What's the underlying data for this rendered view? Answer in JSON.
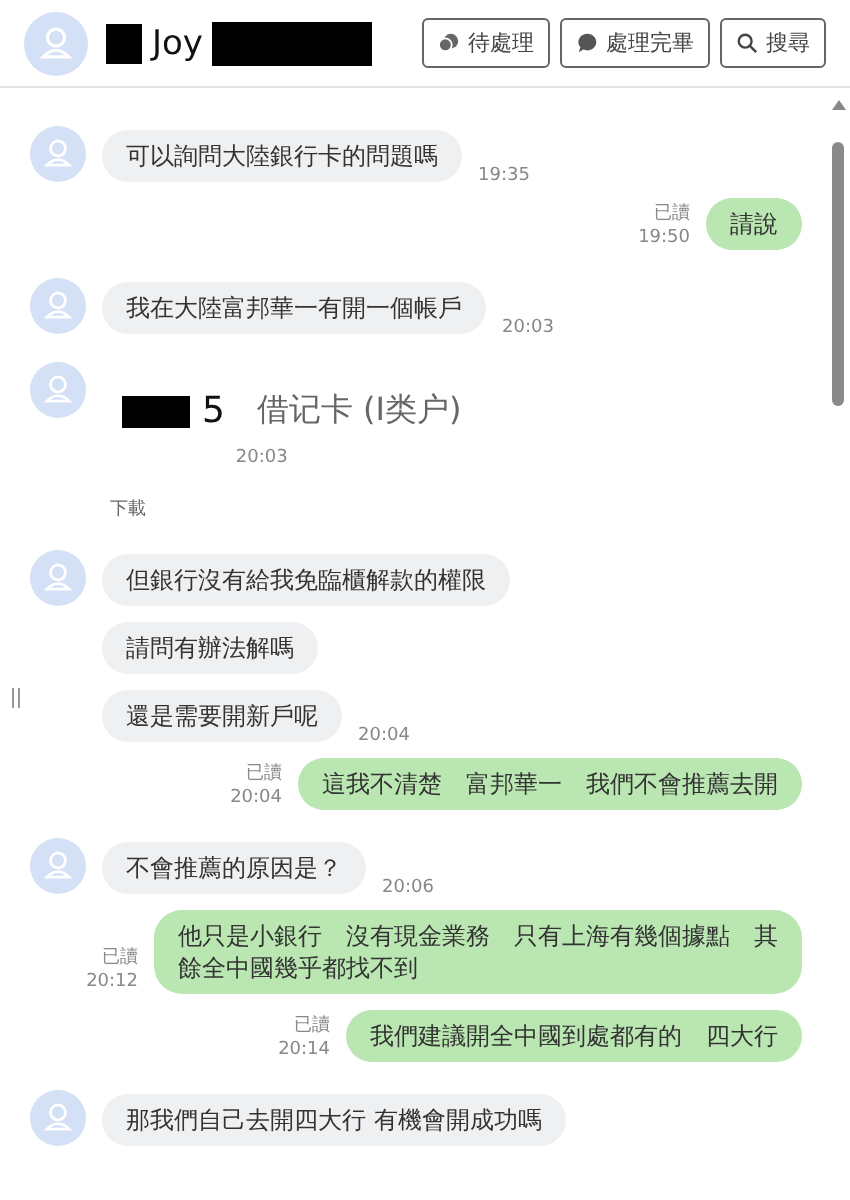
{
  "header": {
    "contact_name": "Joy",
    "buttons": [
      {
        "kind": "pending",
        "label": "待處理"
      },
      {
        "kind": "done",
        "label": "處理完畢"
      },
      {
        "kind": "search",
        "label": "搜尋"
      }
    ]
  },
  "messages": [
    {
      "kind": "incoming",
      "avatar": true,
      "text": "可以詢問大陸銀行卡的問題嗎",
      "time": "19:35"
    },
    {
      "kind": "outgoing",
      "text": "請說",
      "status": "已讀",
      "time": "19:50"
    },
    {
      "kind": "incoming",
      "avatar": true,
      "text": "我在大陸富邦華一有開一個帳戶",
      "time": "20:03"
    },
    {
      "kind": "image",
      "avatar": true,
      "number": "5",
      "caption": "借记卡 (I类户)",
      "time": "20:03",
      "download": "下載"
    },
    {
      "kind": "incoming",
      "avatar": true,
      "text": "但銀行沒有給我免臨櫃解款的權限"
    },
    {
      "kind": "incoming",
      "avatar": false,
      "text": "請問有辦法解嗎"
    },
    {
      "kind": "incoming",
      "avatar": false,
      "text": "還是需要開新戶呢",
      "time": "20:04"
    },
    {
      "kind": "outgoing",
      "text": "這我不清楚　富邦華一　我們不會推薦去開",
      "status": "已讀",
      "time": "20:04"
    },
    {
      "kind": "incoming",
      "avatar": true,
      "text": "不會推薦的原因是？",
      "time": "20:06"
    },
    {
      "kind": "outgoing",
      "text": "他只是小銀行　沒有現金業務　只有上海有幾個據點　其餘全中國幾乎都找不到",
      "status": "已讀",
      "time": "20:12"
    },
    {
      "kind": "outgoing",
      "text": "我們建議開全中國到處都有的　四大行",
      "status": "已讀",
      "time": "20:14"
    },
    {
      "kind": "incoming",
      "avatar": true,
      "text": "那我們自己去開四大行 有機會開成功嗎"
    }
  ]
}
